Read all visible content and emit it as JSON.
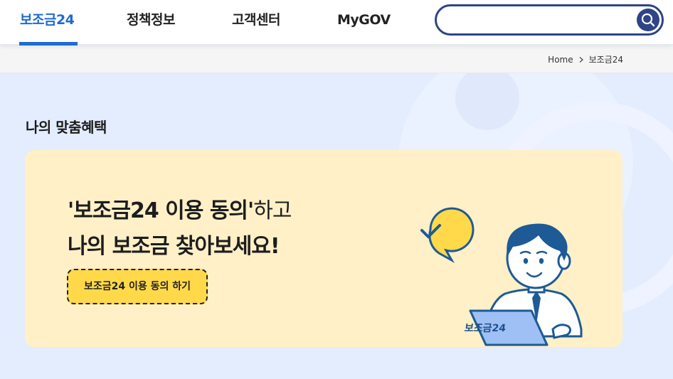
{
  "header": {
    "tabs": [
      {
        "label": "보조금24",
        "active": true
      },
      {
        "label": "정책정보",
        "active": false
      },
      {
        "label": "고객센터",
        "active": false
      },
      {
        "label": "MyGOV",
        "active": false
      }
    ],
    "search": {
      "value": "",
      "placeholder": ""
    }
  },
  "breadcrumb": {
    "home": "Home",
    "current": "보조금24"
  },
  "main": {
    "section_title": "나의 맞춤혜택",
    "banner": {
      "line1_bold": "'보조금24 이용 동의'",
      "line1_rest": "하고",
      "line2": "나의 보조금 찾아보세요!",
      "cta_label": "보조금24 이용 동의 하기",
      "laptop_label": "보조금24"
    }
  },
  "colors": {
    "accent": "#1f6bd1",
    "search_border": "#2d4487",
    "banner_bg": "#fff0c7",
    "cta_bg": "#ffd94a",
    "page_bg": "#e3edfe"
  },
  "icons": [
    "search-icon",
    "chevron-right-icon",
    "check-speech-bubble-icon"
  ]
}
